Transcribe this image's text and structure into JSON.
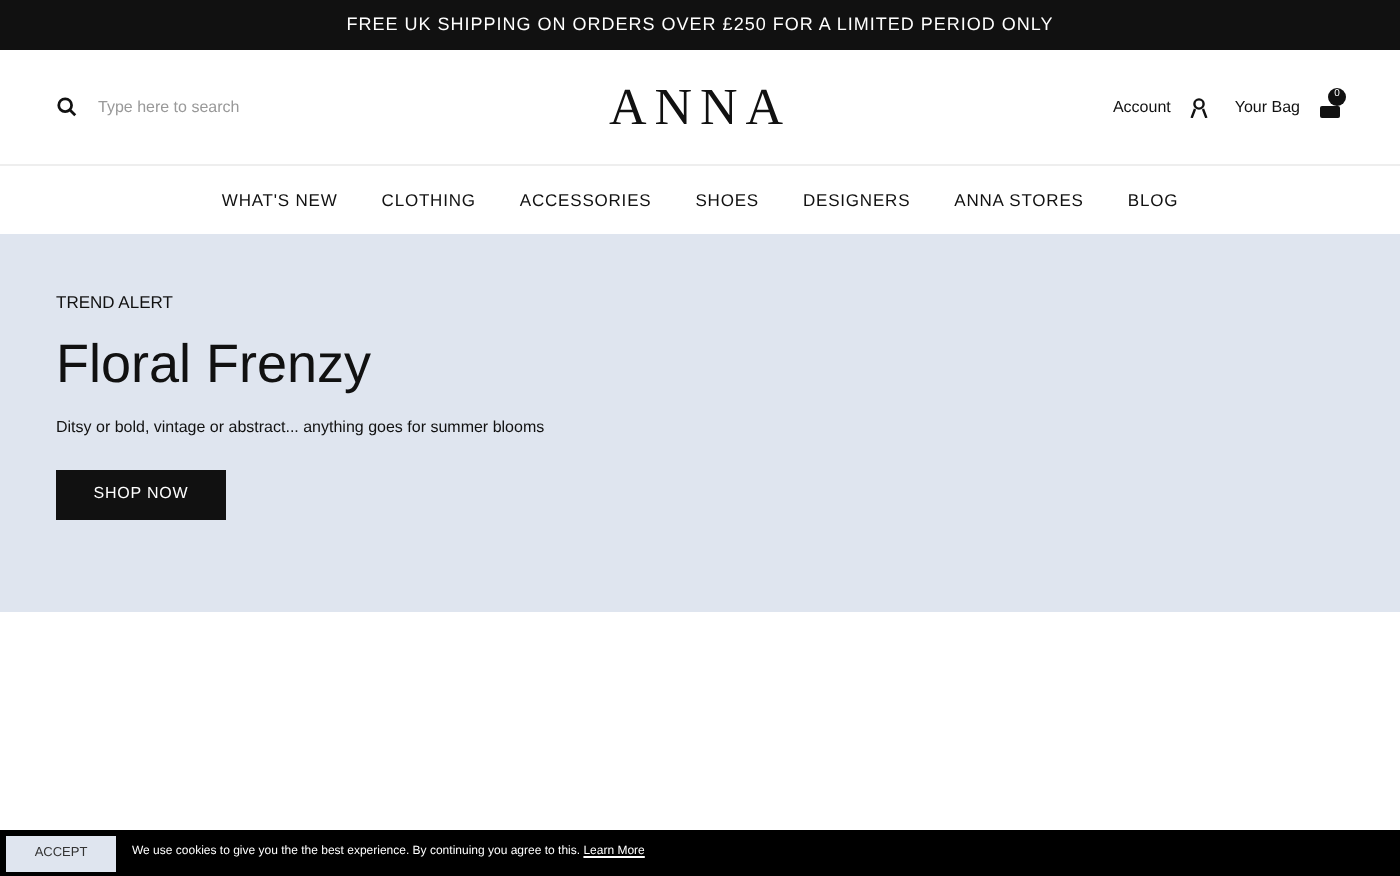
{
  "promo_bar": {
    "text": "FREE UK SHIPPING ON ORDERS OVER £250 FOR A LIMITED PERIOD ONLY"
  },
  "header": {
    "search": {
      "placeholder": "Type here to search"
    },
    "logo": "ANNA",
    "account": "Account",
    "bag": {
      "label": "Your Bag",
      "count": "0"
    }
  },
  "nav": [
    "WHAT'S NEW",
    "CLOTHING",
    "ACCESSORIES",
    "SHOES",
    "DESIGNERS",
    "ANNA STORES",
    "BLOG"
  ],
  "hero": {
    "eyebrow": "TREND ALERT",
    "title": "Floral Frenzy",
    "subtitle": "Ditsy or bold, vintage or abstract... anything goes for summer blooms",
    "button": "SHOP NOW"
  },
  "cookie_bar": {
    "button": "ACCEPT",
    "text": "We use cookies to give you the the best experience. By continuing you agree to this.",
    "link": "Learn More"
  }
}
